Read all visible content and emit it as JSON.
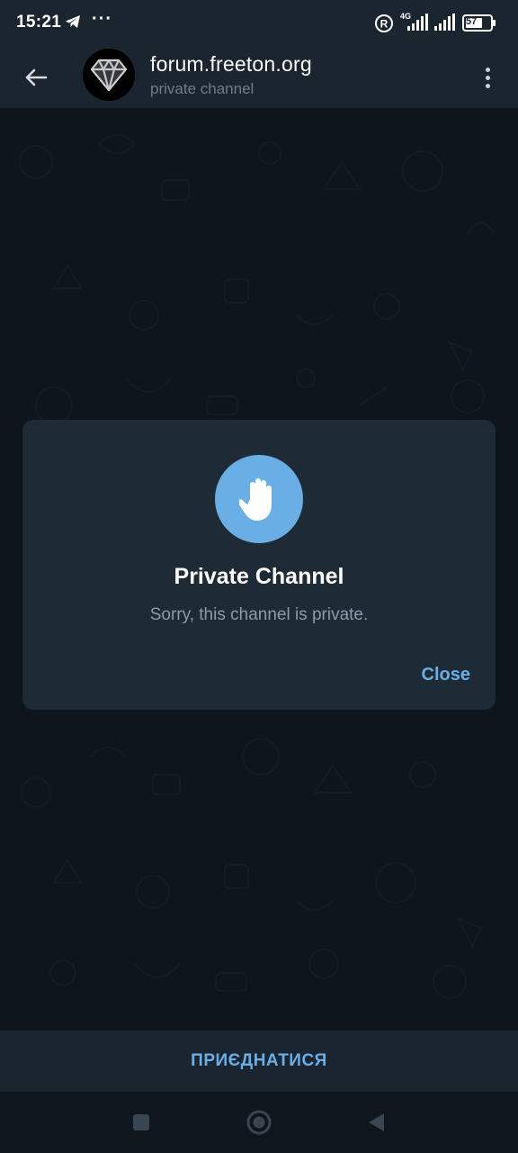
{
  "status_bar": {
    "time": "15:21",
    "dots": "···",
    "network": "4G",
    "battery": "57",
    "icons": [
      "telegram-icon",
      "registered-icon",
      "signal-4g-icon",
      "signal-icon",
      "battery-icon"
    ]
  },
  "header": {
    "title": "forum.freeton.org",
    "subtitle": "private channel",
    "back_icon": "arrow-left-icon",
    "menu_icon": "more-vertical-icon",
    "avatar_icon": "diamond-logo"
  },
  "dialog": {
    "icon": "hand-stop-icon",
    "title": "Private Channel",
    "message": "Sorry, this channel is private.",
    "close_label": "Close"
  },
  "join_bar": {
    "label": "ПРИЄДНАТИСЯ"
  },
  "nav_bar": {
    "icons": [
      "recents-square-icon",
      "home-circle-icon",
      "back-triangle-icon"
    ]
  },
  "colors": {
    "header_bg": "#1b2530",
    "chat_bg": "#0e151d",
    "dialog_bg": "#1f2a37",
    "accent": "#6aaee6",
    "subtitle": "#6f7d8b",
    "message_text": "#8e9aa7"
  }
}
